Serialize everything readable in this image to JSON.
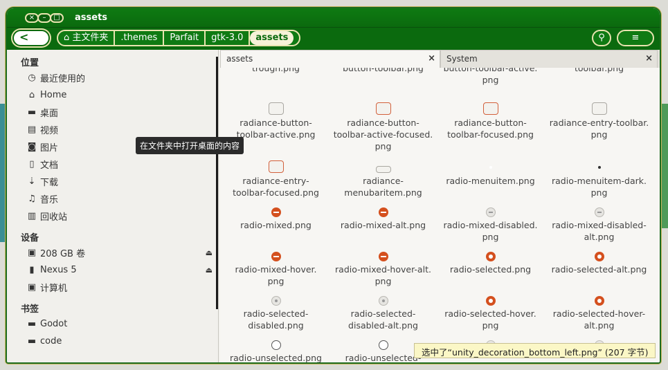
{
  "window": {
    "title": "assets"
  },
  "toolbar": {
    "back_label": "<",
    "breadcrumbs": [
      "主文件夹",
      ".themes",
      "Parfait",
      "gtk-3.0",
      "assets"
    ],
    "search_label": "⚲",
    "menu_label": "≡"
  },
  "sidebar": {
    "sections": [
      {
        "title": "位置",
        "items": [
          "最近使用的",
          "Home",
          "桌面",
          "视频",
          "图片",
          "文档",
          "下载",
          "音乐",
          "回收站"
        ]
      },
      {
        "title": "设备",
        "items": [
          "208 GB 卷",
          "Nexus 5",
          "计算机"
        ]
      },
      {
        "title": "书签",
        "items": [
          "Godot",
          "code"
        ]
      }
    ],
    "icons": [
      "clock-icon",
      "home-icon",
      "folder-icon",
      "film-icon",
      "camera-icon",
      "document-icon",
      "download-icon",
      "music-icon",
      "trash-icon",
      "drive-icon",
      "phone-icon",
      "computer-icon",
      "folder-icon",
      "folder-icon"
    ]
  },
  "tooltip": "在文件夹中打开桌面的内容",
  "tabs": [
    {
      "label": "assets",
      "close": "×"
    },
    {
      "label": "System",
      "close": "×"
    }
  ],
  "files": [
    [
      "trough.png",
      "button-toolbar.png",
      "button-toolbar-active.\npng",
      "toolbar.png"
    ],
    [
      "radiance-button-\ntoolbar-active.png",
      "radiance-button-\ntoolbar-active-focused.\npng",
      "radiance-button-\ntoolbar-focused.png",
      "radiance-entry-toolbar.\npng"
    ],
    [
      "radiance-entry-\ntoolbar-focused.png",
      "radiance-\nmenubaritem.png",
      "radio-menuitem.png",
      "radio-menuitem-dark.\npng"
    ],
    [
      "radio-mixed.png",
      "radio-mixed-alt.png",
      "radio-mixed-disabled.\npng",
      "radio-mixed-disabled-\nalt.png"
    ],
    [
      "radio-mixed-hover.\npng",
      "radio-mixed-hover-alt.\npng",
      "radio-selected.png",
      "radio-selected-alt.png"
    ],
    [
      "radio-selected-\ndisabled.png",
      "radio-selected-\ndisabled-alt.png",
      "radio-selected-hover.\npng",
      "radio-selected-hover-\nalt.png"
    ],
    [
      "radio-unselected.png",
      "radio-unselected-",
      "",
      ""
    ]
  ],
  "status": "选中了“unity_decoration_bottom_left.png” (207 字节)"
}
